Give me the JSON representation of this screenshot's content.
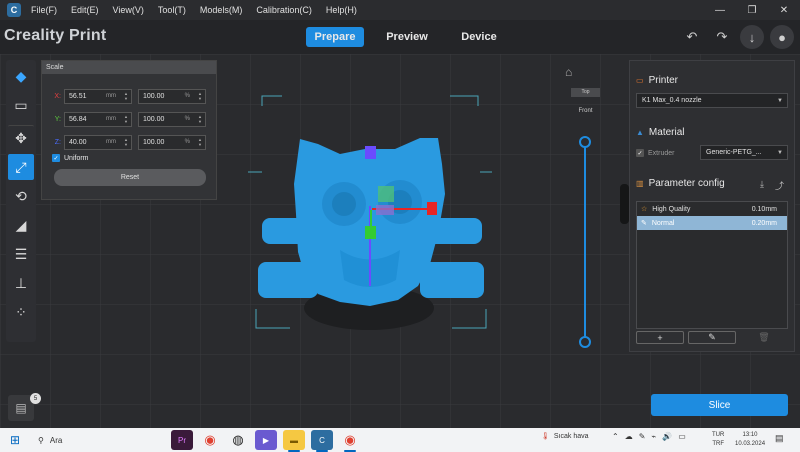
{
  "menubar": {
    "app_icon": "C",
    "items": [
      "File(F)",
      "Edit(E)",
      "View(V)",
      "Tool(T)",
      "Models(M)",
      "Calibration(C)",
      "Help(H)"
    ],
    "window_controls": [
      "minimize-icon",
      "restore-icon",
      "close-icon"
    ]
  },
  "toolbar": {
    "brand": "Creality Print",
    "tabs": [
      {
        "label": "Prepare",
        "active": true
      },
      {
        "label": "Preview",
        "active": false
      },
      {
        "label": "Device",
        "active": false
      }
    ],
    "icons": [
      "undo-icon",
      "redo-icon",
      "download-icon",
      "account-icon"
    ]
  },
  "side_tools": [
    "cube-icon",
    "open-folder-icon",
    "move-icon",
    "scale-icon",
    "rotate-icon",
    "lay-flat-icon",
    "list-icon",
    "support-icon",
    "arrange-icon"
  ],
  "scale_panel": {
    "title": "Scale",
    "rows": [
      {
        "axis": "X:",
        "size": "56.51",
        "unit": "mm",
        "percent": "100.00",
        "pct_unit": "%",
        "color": "#e84040"
      },
      {
        "axis": "Y:",
        "size": "56.84",
        "unit": "mm",
        "percent": "100.00",
        "pct_unit": "%",
        "color": "#5ecc3e"
      },
      {
        "axis": "Z:",
        "size": "40.00",
        "unit": "mm",
        "percent": "100.00",
        "pct_unit": "%",
        "color": "#4a6cff"
      }
    ],
    "uniform_label": "Uniform",
    "uniform_checked": true,
    "reset_label": "Reset"
  },
  "file_badge": "5",
  "view_slider": {
    "top_label": "Top",
    "front_label": "Front"
  },
  "right_panel": {
    "printer_title": "Printer",
    "printer_value": "K1 Max_0.4 nozzle",
    "material_title": "Material",
    "extruder_label": "Extruder",
    "material_value": "Generic-PETG_...",
    "param_title": "Parameter config",
    "presets": [
      {
        "name": "High Quality",
        "value": "0.10mm",
        "selected": false
      },
      {
        "name": "Normal",
        "value": "0.20mm",
        "selected": true
      }
    ],
    "add_label": "+",
    "edit_icon": "edit-icon",
    "delete_icon": "trash-icon"
  },
  "slice_label": "Slice",
  "taskbar": {
    "search_placeholder": "Ara",
    "weather": "Sıcak hava",
    "language": [
      "TUR",
      "TRF"
    ],
    "time": "13:10",
    "date": "10.03.2024"
  },
  "colors": {
    "accent": "#1e8ce0",
    "model": "#2a9ae0",
    "axis_x": "#e82525",
    "axis_y": "#33cc33",
    "axis_z": "#6a4cff"
  }
}
